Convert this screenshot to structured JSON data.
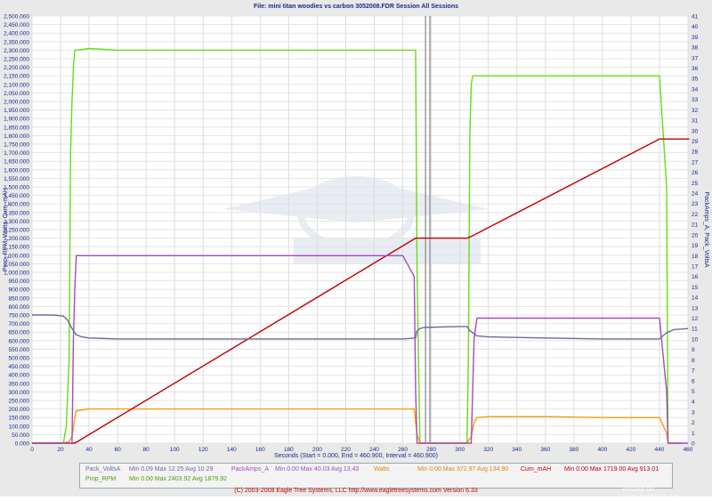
{
  "title": "File: mini titan woodies vs carbon 3052008.FDR   Session All Sessions",
  "chart_data": {
    "type": "line",
    "title": "File: mini titan woodies vs carbon 3052008.FDR   Session All Sessions",
    "xlabel": "Seconds (Start = 0.000,  End = 460.900,  Interval = 460.900)",
    "ylabel_left": "Prop_RPM, Watts, Cum_mAH",
    "ylabel_right": "PackAmps_A, Pack_VoltsA",
    "xlim": [
      0,
      460
    ],
    "ylim_left": [
      0,
      2500
    ],
    "ylim_right": [
      0,
      41
    ],
    "x_ticks": [
      0,
      20,
      40,
      60,
      80,
      100,
      120,
      140,
      160,
      180,
      200,
      220,
      240,
      260,
      280,
      300,
      320,
      340,
      360,
      380,
      400,
      420,
      440,
      460
    ],
    "y_left_ticks": [
      0,
      50,
      100,
      150,
      200,
      250,
      300,
      350,
      400,
      450,
      500,
      550,
      600,
      650,
      700,
      750,
      800,
      850,
      900,
      950,
      1000,
      1050,
      1100,
      1150,
      1200,
      1250,
      1300,
      1350,
      1400,
      1450,
      1500,
      1550,
      1600,
      1650,
      1700,
      1750,
      1800,
      1850,
      1900,
      1950,
      2000,
      2050,
      2100,
      2150,
      2200,
      2250,
      2300,
      2350,
      2400,
      2450,
      2500
    ],
    "y_right_ticks": [
      0,
      1,
      2,
      3,
      4,
      5,
      6,
      7,
      8,
      9,
      10,
      11,
      12,
      13,
      14,
      15,
      16,
      17,
      18,
      19,
      20,
      21,
      22,
      23,
      24,
      25,
      26,
      27,
      28,
      29,
      30,
      31,
      32,
      33,
      34,
      35,
      36,
      37,
      38,
      39,
      40,
      41
    ],
    "session_breaks": [
      276,
      279
    ],
    "grid": true,
    "series": [
      {
        "name": "Prop_RPM",
        "axis": "left",
        "color": "#66dd11",
        "x": [
          0,
          22,
          24,
          26,
          27,
          28,
          29,
          30,
          31,
          40,
          60,
          100,
          140,
          180,
          220,
          260,
          269,
          270,
          272,
          273,
          275,
          300,
          305,
          306,
          307,
          308,
          309,
          310,
          312,
          320,
          360,
          400,
          440,
          445,
          446,
          450,
          455
        ],
        "values": [
          0,
          0,
          100,
          500,
          1700,
          2000,
          2200,
          2300,
          2300,
          2310,
          2300,
          2300,
          2300,
          2300,
          2300,
          2300,
          2300,
          1000,
          0,
          0,
          0,
          0,
          0,
          500,
          1800,
          2100,
          2150,
          2150,
          2150,
          2150,
          2150,
          2150,
          2150,
          1500,
          0,
          0,
          0
        ]
      },
      {
        "name": "Watts",
        "axis": "left",
        "color": "#f39c12",
        "x": [
          0,
          22,
          26,
          28,
          30,
          31,
          40,
          100,
          180,
          260,
          268,
          270,
          272,
          275,
          300,
          305,
          308,
          310,
          312,
          320,
          360,
          400,
          440,
          445,
          446,
          455
        ],
        "values": [
          0,
          0,
          10,
          40,
          150,
          190,
          200,
          200,
          200,
          200,
          200,
          50,
          0,
          0,
          0,
          0,
          40,
          120,
          150,
          155,
          155,
          150,
          150,
          60,
          0,
          0
        ]
      },
      {
        "name": "Cum_mAh",
        "axis": "left",
        "color": "#c00000",
        "x": [
          0,
          28,
          30,
          269,
          270,
          300,
          305,
          308,
          440,
          447,
          460.9
        ],
        "values": [
          0,
          0,
          0,
          1200,
          1200,
          1200,
          1200,
          1210,
          1780,
          1780,
          1780
        ]
      },
      {
        "name": "PackAmps_A",
        "axis": "right",
        "color": "#a24cbf",
        "x": [
          0,
          22,
          28,
          29,
          30,
          31,
          40,
          60,
          100,
          140,
          180,
          220,
          260,
          268,
          269,
          270,
          272,
          275,
          300,
          305,
          308,
          310,
          312,
          320,
          360,
          400,
          440,
          445,
          446,
          450,
          460
        ],
        "values": [
          0,
          0,
          0,
          10,
          15,
          18,
          18,
          18,
          18,
          18,
          18,
          18,
          18,
          16,
          5,
          0,
          0,
          0,
          0,
          0,
          0,
          10,
          12,
          12,
          12,
          12,
          12,
          5,
          0,
          0,
          0
        ]
      },
      {
        "name": "Pack_VoltsA",
        "axis": "right",
        "color": "#6a6a99",
        "x": [
          0,
          5,
          15,
          22,
          25,
          28,
          30,
          31,
          35,
          40,
          60,
          100,
          140,
          180,
          220,
          260,
          269,
          270,
          272,
          275,
          300,
          305,
          307,
          310,
          312,
          320,
          360,
          400,
          440,
          445,
          450,
          460
        ],
        "values": [
          12.3,
          12.3,
          12.3,
          12.2,
          11.8,
          11.0,
          10.6,
          10.4,
          10.2,
          10.1,
          10.0,
          10.0,
          10.0,
          10.0,
          10.0,
          10.0,
          10.1,
          10.8,
          11.0,
          11.1,
          11.2,
          11.2,
          10.8,
          10.5,
          10.3,
          10.2,
          10.1,
          10.0,
          10.0,
          10.6,
          10.9,
          11.0
        ]
      }
    ]
  },
  "legend": [
    {
      "name": "Pack_VoltsA",
      "stats": "Min 0.09    Max 12.25    Avg 10.29",
      "color": "#6a6a99"
    },
    {
      "name": "Prop_RPM",
      "stats": "Min 0.00    Max 2403.92    Avg 1879.92",
      "color": "#66dd11"
    },
    {
      "name": "PackAmps_A",
      "stats": "Min 0.00    Max 40.03    Avg 13.43",
      "color": "#a24cbf"
    },
    {
      "name": "Watts",
      "stats": "Min 0.00    Max 372.97    Avg 134.90",
      "color": "#f39c12"
    },
    {
      "name": "Cum_mAH",
      "stats": "Min 0.00    Max 1719.00    Avg 913.01",
      "color": "#c00000"
    }
  ],
  "copyright": "(C) 2003-2008 Eagle Tree Systems, LLC    http://www.eagletreesystems.com    Version 6.33",
  "watermark": "hosted on www.helifreak.com"
}
